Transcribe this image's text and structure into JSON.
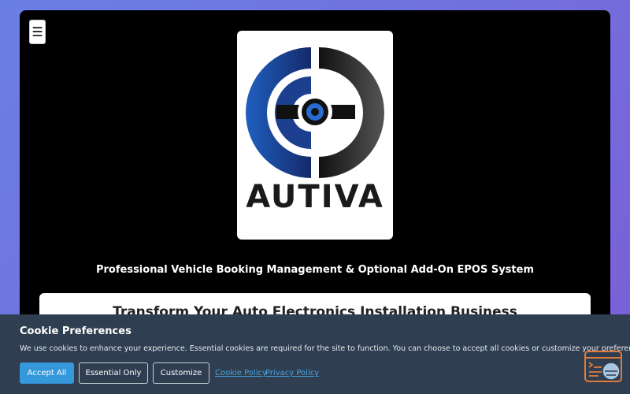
{
  "header": {
    "menu_icon": "☰",
    "logo_text": "AUTIVA"
  },
  "hero": {
    "tagline": "Professional Vehicle Booking Management & Optional Add-On EPOS System",
    "heading": "Transform Your Auto Electronics Installation Business"
  },
  "cookie": {
    "title": "Cookie Preferences",
    "text": "We use cookies to enhance your experience. Essential cookies are required for the site to function. You can choose to accept all cookies or customize your preferences.",
    "accept_label": "Accept All",
    "essential_label": "Essential Only",
    "customize_label": "Customize",
    "cookie_policy_label": "Cookie Policy",
    "privacy_policy_label": "Privacy Policy"
  },
  "colors": {
    "accent": "#3498db",
    "banner": "#2f3e50",
    "fab": "#e07b39"
  },
  "icons": {
    "menu": "hamburger-icon",
    "fab": "cookie-settings-icon"
  }
}
